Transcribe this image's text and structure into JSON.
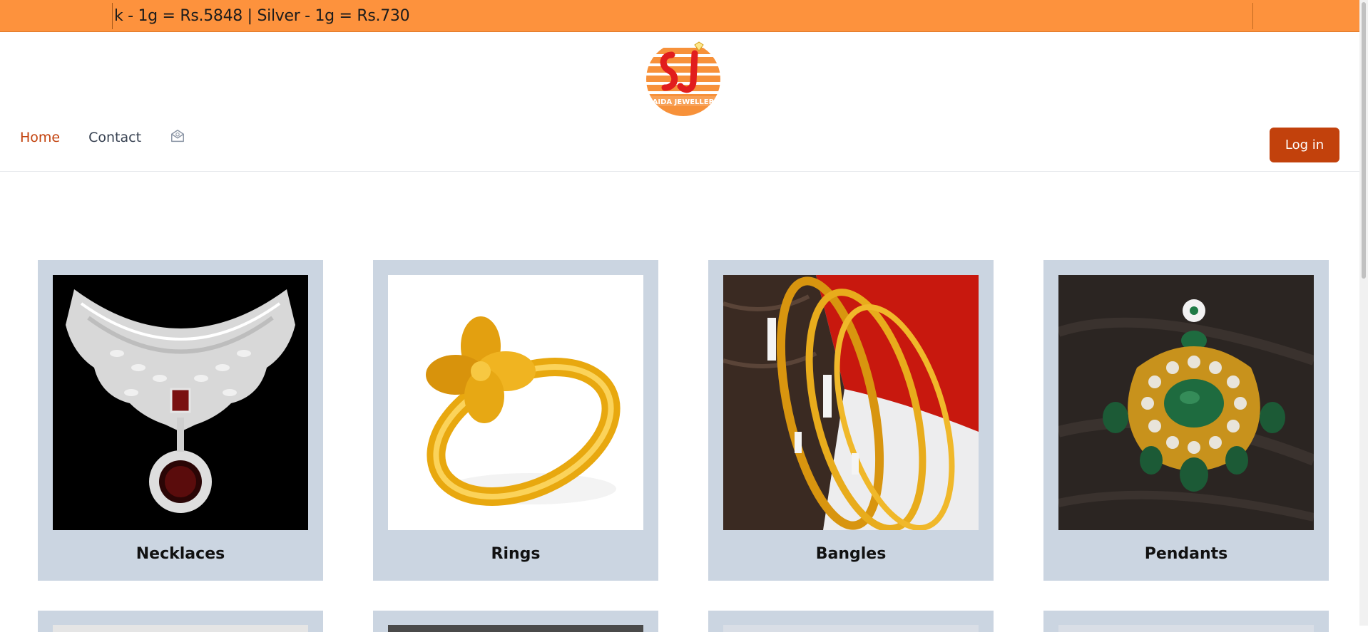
{
  "ticker": {
    "text": "k - 1g = Rs.5848 | Silver - 1g = Rs.730"
  },
  "brand": {
    "logo_text": "SAIDA JEWELLERS",
    "accent": "#fd923d",
    "primary": "#c2410c"
  },
  "nav": {
    "home": "Home",
    "contact": "Contact",
    "mail_icon": "mail-icon"
  },
  "auth": {
    "login_label": "Log in"
  },
  "categories": [
    {
      "label": "Necklaces",
      "icon": "necklace-image"
    },
    {
      "label": "Rings",
      "icon": "ring-image"
    },
    {
      "label": "Bangles",
      "icon": "bangles-image"
    },
    {
      "label": "Pendants",
      "icon": "pendant-image"
    }
  ]
}
